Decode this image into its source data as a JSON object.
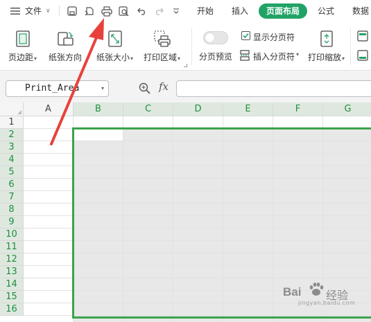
{
  "menubar": {
    "menu_label": "文件",
    "tabs": [
      "开始",
      "插入",
      "页面布局",
      "公式",
      "数据"
    ],
    "active_tab": "页面布局"
  },
  "ribbon": {
    "margins": "页边距",
    "orientation": "纸张方向",
    "size": "纸张大小",
    "print_area": "打印区域",
    "page_break_preview": "分页预览",
    "show_page_break": "显示分页符",
    "show_page_break_checked": true,
    "insert_page_break": "插入分页符",
    "print_scaling": "打印缩放"
  },
  "formula_bar": {
    "name_box": "Print_Area",
    "fx_label": "fx",
    "formula": ""
  },
  "grid": {
    "columns": [
      "A",
      "B",
      "C",
      "D",
      "E",
      "F",
      "G"
    ],
    "rows": [
      "1",
      "2",
      "3",
      "4",
      "5",
      "6",
      "7",
      "8",
      "9",
      "10",
      "11",
      "12",
      "13",
      "14",
      "15",
      "16"
    ],
    "selected_columns": [
      "B",
      "C",
      "D",
      "E",
      "F",
      "G"
    ],
    "selected_rows_from": 2,
    "print_area_color": "#3aa34a"
  },
  "colors": {
    "accent": "#21a366",
    "annotation_arrow": "#e8413b"
  },
  "watermark": {
    "brand": "Bai",
    "brand_cn": "经验",
    "url": "jingyan.baidu.com"
  }
}
